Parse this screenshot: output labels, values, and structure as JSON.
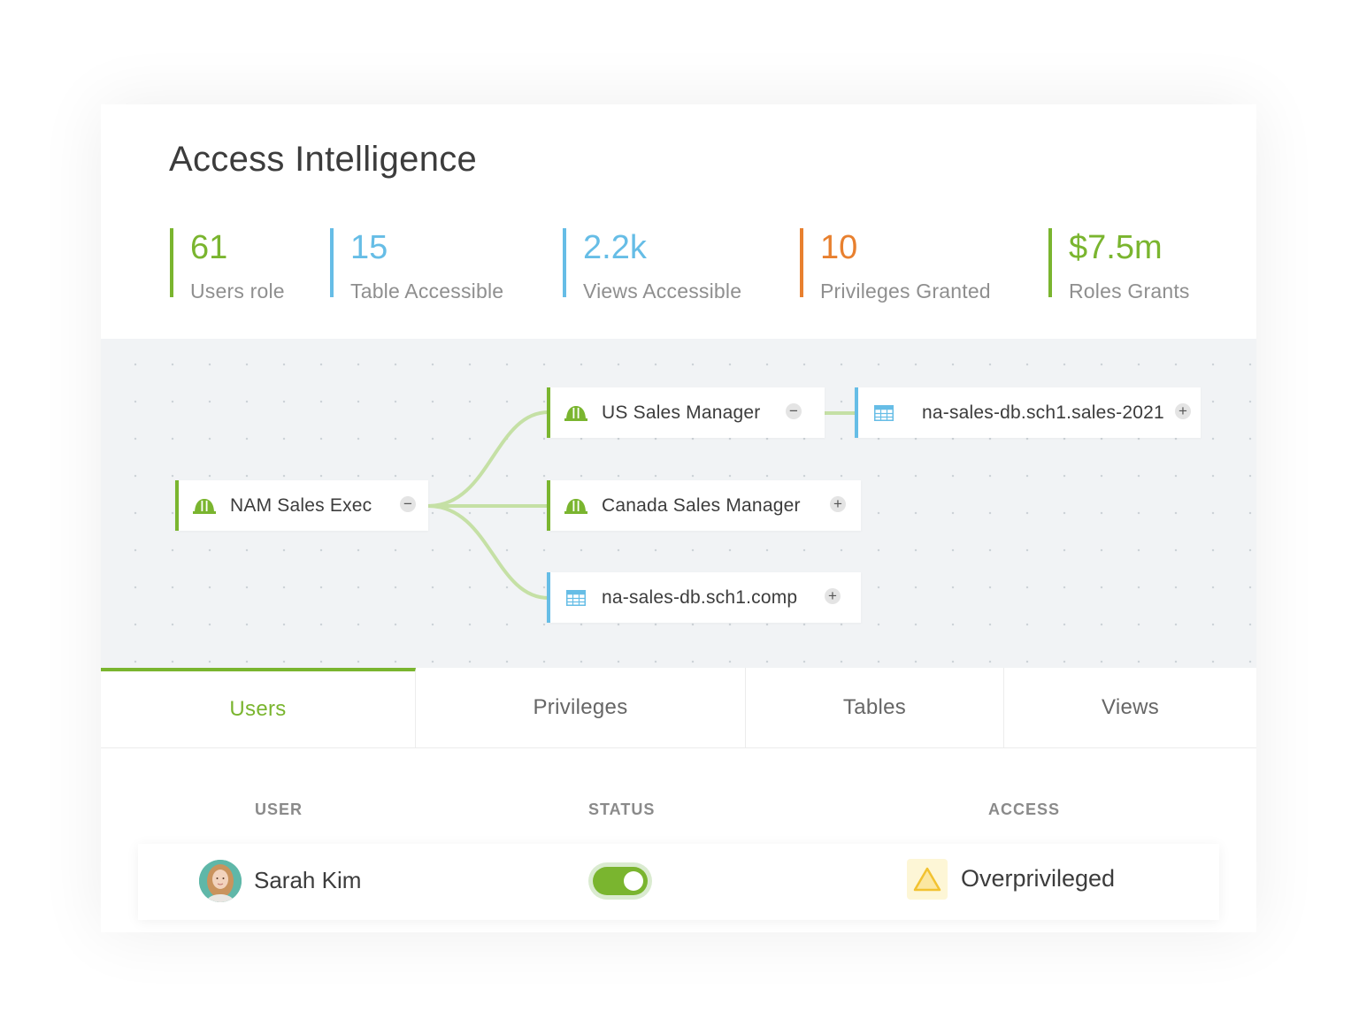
{
  "title": "Access Intelligence",
  "stats": [
    {
      "value": "61",
      "label": "Users role",
      "color": "#7ab52f"
    },
    {
      "value": "15",
      "label": "Table Accessible",
      "color": "#66bde6"
    },
    {
      "value": "2.2k",
      "label": "Views Accessible",
      "color": "#66bde6"
    },
    {
      "value": "10",
      "label": "Privileges Granted",
      "color": "#e8802f"
    },
    {
      "value": "$7.5m",
      "label": "Roles Grants",
      "color": "#7ab52f"
    }
  ],
  "graph": {
    "nodes": {
      "nam_sales_exec": {
        "label": "NAM Sales Exec",
        "icon": "role-icon",
        "toggle": "−"
      },
      "us_sales_manager": {
        "label": "US Sales Manager",
        "icon": "role-icon",
        "toggle": "−"
      },
      "canada_sales_manager": {
        "label": "Canada Sales Manager",
        "icon": "role-icon",
        "toggle": "+"
      },
      "na_sales_comp": {
        "label": "na-sales-db.sch1.comp",
        "icon": "table-icon",
        "toggle": "+"
      },
      "na_sales_2021": {
        "label": "na-sales-db.sch1.sales-2021",
        "icon": "table-icon",
        "toggle": "+"
      }
    }
  },
  "tabs": [
    {
      "label": "Users",
      "active": true
    },
    {
      "label": "Privileges",
      "active": false
    },
    {
      "label": "Tables",
      "active": false
    },
    {
      "label": "Views",
      "active": false
    }
  ],
  "table": {
    "columns": [
      "USER",
      "STATUS",
      "ACCESS"
    ],
    "rows": [
      {
        "user": "Sarah Kim",
        "status": "enabled",
        "access": "Overprivileged",
        "access_icon": "warning-icon"
      }
    ]
  },
  "colors": {
    "accent_green": "#7ab52f",
    "accent_blue": "#66bde6",
    "accent_orange": "#e8802f",
    "warning_yellow": "#f2c230"
  }
}
